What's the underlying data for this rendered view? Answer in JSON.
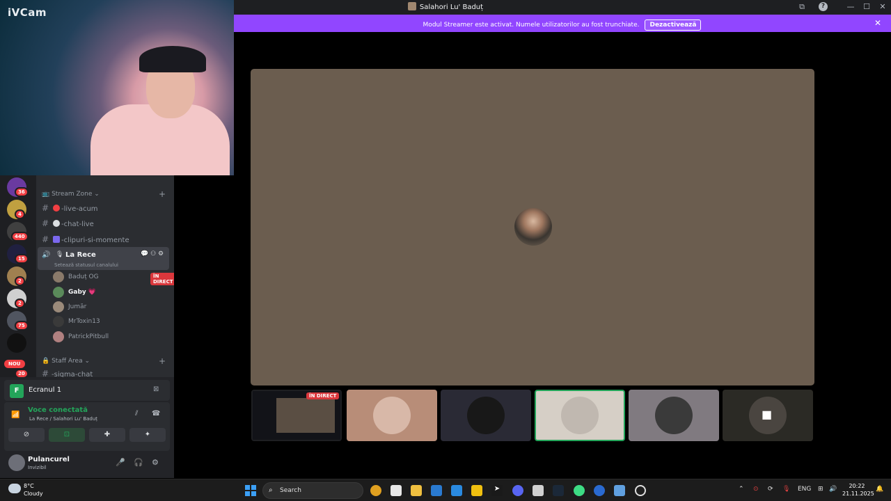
{
  "window": {
    "title": "Salahori Lu' Baduț",
    "minimize": "—",
    "maximize": "☐",
    "close": "✕",
    "screen_icon": "screen-share-icon",
    "help": "?"
  },
  "banner": {
    "message": "Modul Streamer este activat. Numele utilizatorilor au fost trunchiate.",
    "button": "Dezactivează",
    "close": "✕",
    "color": "#9146ff"
  },
  "webcam": {
    "brand": "iVCam"
  },
  "servers": {
    "badges": [
      "36",
      "4",
      "440",
      "15",
      "2",
      "2",
      "75"
    ],
    "new_label": "NOU",
    "last_badge": "20"
  },
  "channels": {
    "category1": "Stream Zone",
    "text_channels": [
      {
        "name": "-live-acum",
        "emoji_color": "#f23f43"
      },
      {
        "name": "-chat-live",
        "emoji_color": "#dbdee1"
      },
      {
        "name": "-clipuri-si-momente",
        "emoji_color": "#7b68ee"
      }
    ],
    "voice_channel": {
      "name": "La Rece",
      "status": "Setează statusul canalului"
    },
    "voice_users": [
      {
        "name": "Baduț OG",
        "live": true,
        "color": "#8a7a6a"
      },
      {
        "name": "Gaby",
        "heart": "💗",
        "color": "#5a8a5a"
      },
      {
        "name": "Jumăr",
        "color": "#9a8a7a"
      },
      {
        "name": "MrToxin13",
        "color": "#3a3a3a"
      },
      {
        "name": "PatrickPitbull",
        "color": "#b08080"
      }
    ],
    "live_label": "ÎN DIRECT",
    "category2": "Staff Area",
    "cut_channel": "-sigma-chat"
  },
  "screen_share": {
    "label": "Ecranul 1"
  },
  "voice_status": {
    "title": "Voce conectată",
    "subtitle": "La Rece / Salahori Lu' Baduț"
  },
  "user": {
    "name": "Pulancurel",
    "status": "Invizibil"
  },
  "grid": {
    "live_label": "ÎN DIRECT"
  },
  "taskbar": {
    "temp": "8°C",
    "condition": "Cloudy",
    "search": "Search",
    "lang": "ENG",
    "time": "20:22",
    "date": "21.11.2025"
  }
}
